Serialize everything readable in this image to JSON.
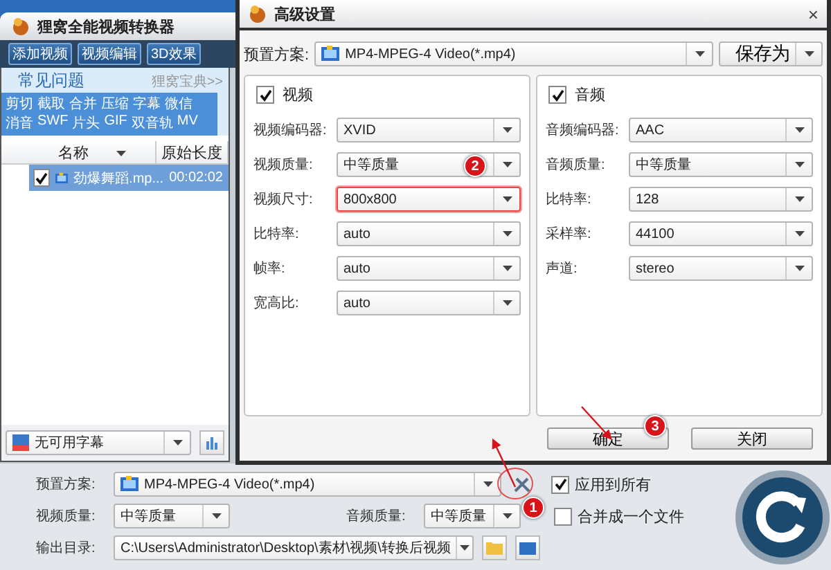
{
  "main_window": {
    "title": "狸窝全能视频转换器",
    "toolbar": [
      "添加视频",
      "视频编辑",
      "3D效果"
    ],
    "help": {
      "title": "常见问题",
      "link": "狸窝宝典>>",
      "topics": [
        "剪切",
        "截取",
        "合并",
        "压缩",
        "字幕",
        "微信",
        "消音",
        "SWF",
        "片头",
        "GIF",
        "双音轨",
        "MV"
      ]
    },
    "file_list": {
      "columns": [
        "名称",
        "原始长度"
      ],
      "rows": [
        {
          "name": "劲爆舞蹈.mp...",
          "duration": "00:02:02",
          "checked": true,
          "selected": true
        }
      ]
    },
    "subtitle": "无可用字幕",
    "bottom": {
      "preset_label": "预置方案:",
      "preset": "MP4-MPEG-4 Video(*.mp4)",
      "apply_all": {
        "label": "应用到所有",
        "checked": true
      },
      "video_quality_label": "视频质量:",
      "video_quality": "中等质量",
      "audio_quality_label": "音频质量:",
      "audio_quality": "中等质量",
      "merge": {
        "label": "合并成一个文件",
        "checked": false
      },
      "output_label": "输出目录:",
      "output": "C:\\Users\\Administrator\\Desktop\\素材\\视频\\转换后视频"
    }
  },
  "dialog": {
    "title": "高级设置",
    "close": "×",
    "preset_label": "预置方案:",
    "preset": "MP4-MPEG-4 Video(*.mp4)",
    "save_as": "保存为",
    "groups": [
      {
        "title": "视频",
        "checked": true,
        "fields": [
          {
            "label": "视频编码器:",
            "value": "XVID",
            "highlighted": false
          },
          {
            "label": "视频质量:",
            "value": "中等质量",
            "highlighted": false
          },
          {
            "label": "视频尺寸:",
            "value": "800x800",
            "highlighted": true
          },
          {
            "label": "比特率:",
            "value": "auto",
            "highlighted": false
          },
          {
            "label": "帧率:",
            "value": "auto",
            "highlighted": false
          },
          {
            "label": "宽高比:",
            "value": "auto",
            "highlighted": false
          }
        ]
      },
      {
        "title": "音频",
        "checked": true,
        "fields": [
          {
            "label": "音频编码器:",
            "value": "AAC",
            "highlighted": false
          },
          {
            "label": "音频质量:",
            "value": "中等质量",
            "highlighted": false
          },
          {
            "label": "比特率:",
            "value": "128",
            "highlighted": false
          },
          {
            "label": "采样率:",
            "value": "44100",
            "highlighted": false
          },
          {
            "label": "声道:",
            "value": "stereo",
            "highlighted": false
          }
        ]
      }
    ],
    "buttons": [
      "确定",
      "关闭"
    ]
  },
  "annotations": [
    "1",
    "2",
    "3"
  ]
}
